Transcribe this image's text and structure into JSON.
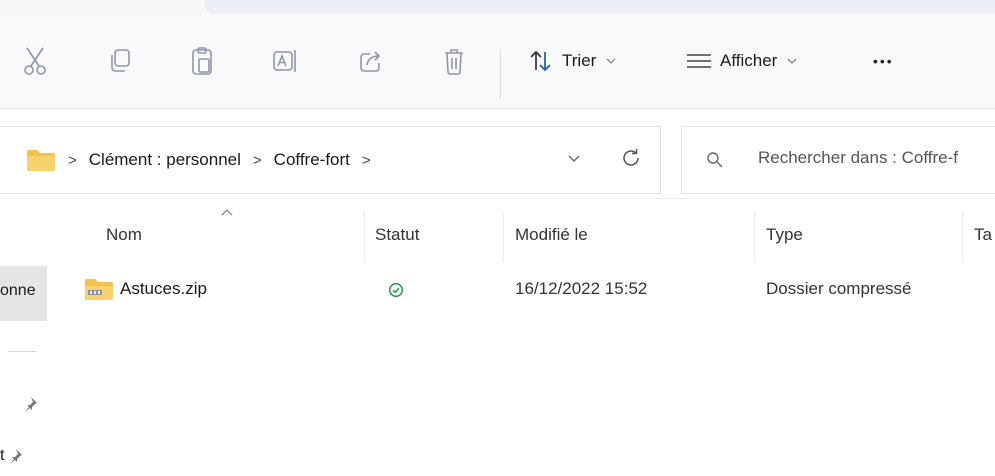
{
  "toolbar": {
    "icons": [
      "cut-icon",
      "copy-icon",
      "paste-icon",
      "rename-icon",
      "share-icon",
      "delete-icon"
    ],
    "sort_label": "Trier",
    "view_label": "Afficher",
    "more_label": "•••"
  },
  "address": {
    "separator": ">",
    "crumbs": [
      "Clément : personnel",
      "Coffre-fort"
    ]
  },
  "search": {
    "placeholder": "Rechercher dans : Coffre-f"
  },
  "sidebar": {
    "selected_label": "onne",
    "row2_label": "t"
  },
  "columns": {
    "name": "Nom",
    "status": "Statut",
    "modified": "Modifié le",
    "type": "Type",
    "size": "Ta"
  },
  "files": [
    {
      "name": "Astuces.zip",
      "status": "synced",
      "modified": "16/12/2022 15:52",
      "type": "Dossier compressé"
    }
  ],
  "colors": {
    "folder": "#f2c14e",
    "status_ok": "#2e9e4f",
    "sort_arrow": "#1560bd",
    "selected_bg": "#e5e5e5"
  }
}
